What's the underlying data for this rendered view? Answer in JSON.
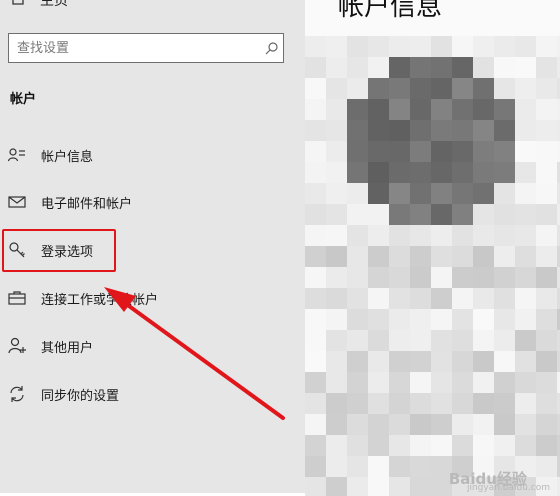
{
  "sidebar": {
    "home_label": "主页",
    "search": {
      "placeholder": "查找设置"
    },
    "section_title": "帐户",
    "items": [
      {
        "label": "帐户信息"
      },
      {
        "label": "电子邮件和帐户"
      },
      {
        "label": "登录选项"
      },
      {
        "label": "连接工作或学校帐户"
      },
      {
        "label": "其他用户"
      },
      {
        "label": "同步你的设置"
      }
    ]
  },
  "content": {
    "title": "帐户信息"
  },
  "watermark": {
    "text": "Baidu经验",
    "sub": "jingyan.baidu.com"
  },
  "colors": {
    "highlight": "#e0161b",
    "sidebar_bg": "#e6e6e6"
  }
}
